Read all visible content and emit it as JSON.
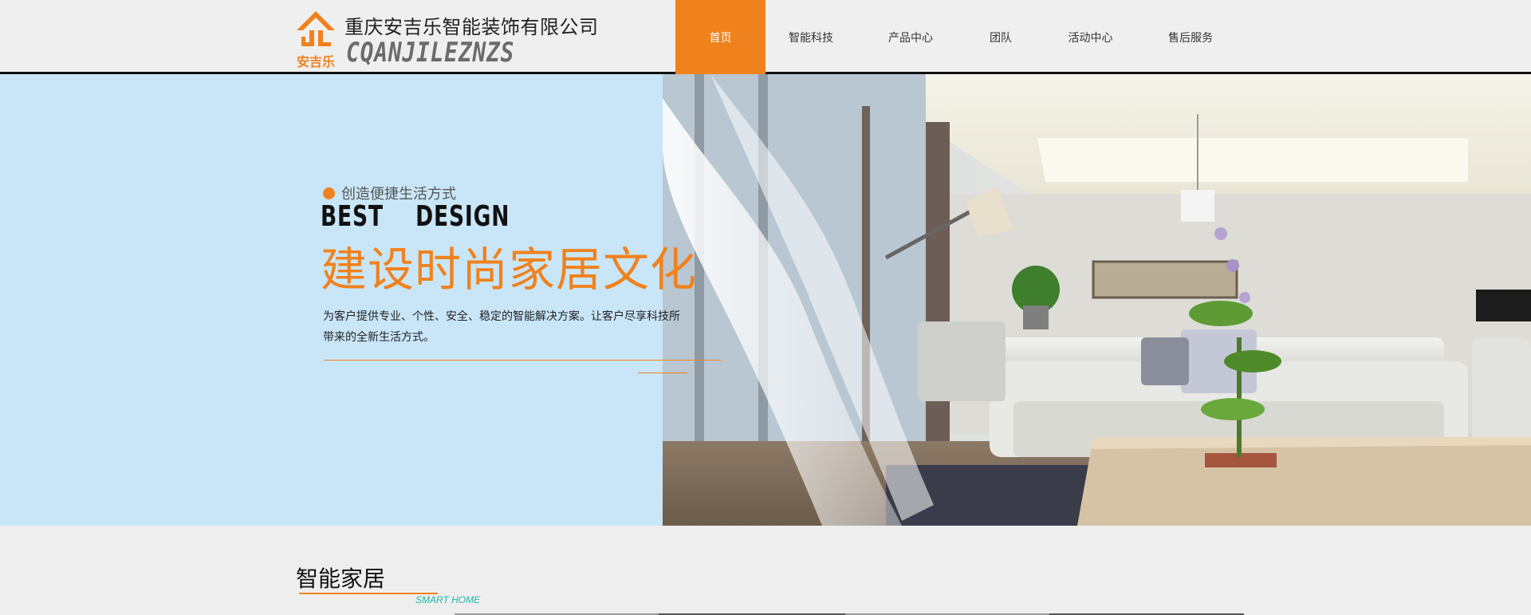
{
  "header": {
    "company_name": "重庆安吉乐智能装饰有限公司",
    "company_en": "CQANJILEZNZS",
    "logo_text": "安吉乐",
    "logo_icon": "house-roof-logo-icon"
  },
  "nav": {
    "items": [
      {
        "label": "首页",
        "active": true
      },
      {
        "label": "智能科技",
        "active": false
      },
      {
        "label": "产品中心",
        "active": false
      },
      {
        "label": "团队",
        "active": false
      },
      {
        "label": "活动中心",
        "active": false
      },
      {
        "label": "售后服务",
        "active": false
      }
    ]
  },
  "hero": {
    "tagline": "创造便捷生活方式",
    "best_design": "BEST    DESIGN",
    "headline": "建设时尚家居文化",
    "description": "为客户提供专业、个性、安全、稳定的智能解决方案。让客户尽享科技所带来的全新生活方式。"
  },
  "section": {
    "title": "智能家居",
    "subtitle": "SMART HOME"
  },
  "colors": {
    "accent": "#f0821e",
    "hero_bg": "#c9e6f8",
    "teal": "#24b3a8",
    "page_bg": "#eeeeee"
  }
}
